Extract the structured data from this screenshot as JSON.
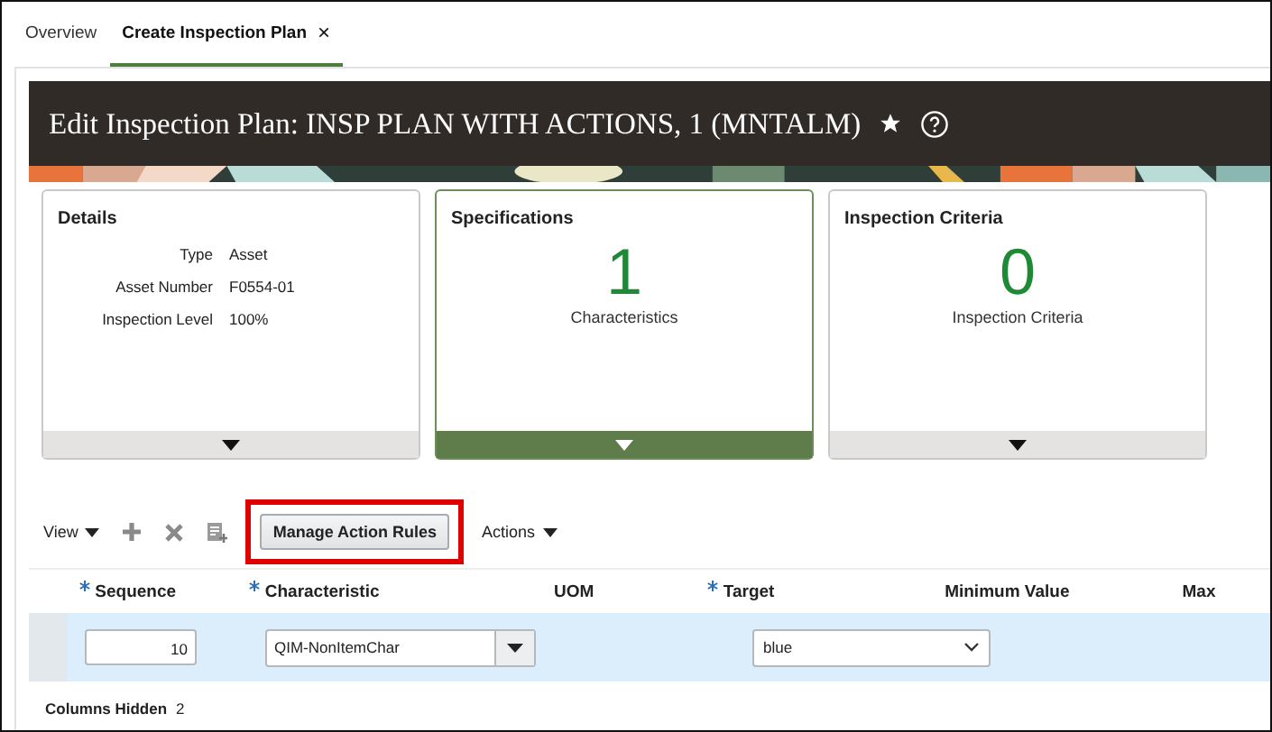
{
  "tabs": [
    {
      "label": "Overview",
      "selected": false
    },
    {
      "label": "Create Inspection Plan",
      "selected": true,
      "close": "×"
    }
  ],
  "header": {
    "title": "Edit Inspection Plan: INSP PLAN WITH ACTIONS, 1 (MNTALM)"
  },
  "cards": [
    {
      "kind": "details",
      "title": "Details",
      "selected": false,
      "fields": [
        {
          "label": "Type",
          "value": "Asset"
        },
        {
          "label": "Asset Number",
          "value": "F0554-01"
        },
        {
          "label": "Inspection Level",
          "value": "100%"
        }
      ]
    },
    {
      "kind": "count",
      "title": "Specifications",
      "selected": true,
      "count": "1",
      "caption": "Characteristics"
    },
    {
      "kind": "count",
      "title": "Inspection Criteria",
      "selected": false,
      "count": "0",
      "caption": "Inspection Criteria"
    }
  ],
  "toolbar": {
    "view": "View",
    "manage_button": "Manage Action Rules",
    "highlighted": true,
    "actions": "Actions"
  },
  "table": {
    "columns": [
      {
        "label": "Sequence",
        "required": true
      },
      {
        "label": "Characteristic",
        "required": true
      },
      {
        "label": "UOM",
        "required": false
      },
      {
        "label": "Target",
        "required": true
      },
      {
        "label": "Minimum Value",
        "required": false
      },
      {
        "label": "Max",
        "required": false
      }
    ],
    "rows": [
      {
        "selected": true,
        "sequence": "10",
        "characteristic": "QIM-NonItemChar",
        "target": "blue"
      }
    ]
  },
  "footer": {
    "label": "Columns Hidden",
    "value": "2"
  }
}
